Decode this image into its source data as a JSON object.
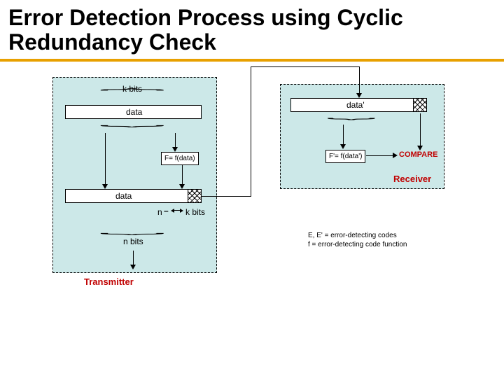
{
  "title": "Error Detection Process using Cyclic Redundancy Check",
  "transmitter": {
    "k_bits": "k bits",
    "data": "data",
    "f_box": "F= f(data)",
    "data2": "data",
    "n_minus": "n",
    "k_bits2": "k bits",
    "n_bits": "n bits",
    "label": "Transmitter"
  },
  "receiver": {
    "data_prime": "data'",
    "f_box": "F'= f(data')",
    "compare": "COMPARE",
    "label": "Receiver"
  },
  "legend": {
    "line1": "E, E' = error-detecting codes",
    "line2": "f       = error-detecting code function"
  }
}
